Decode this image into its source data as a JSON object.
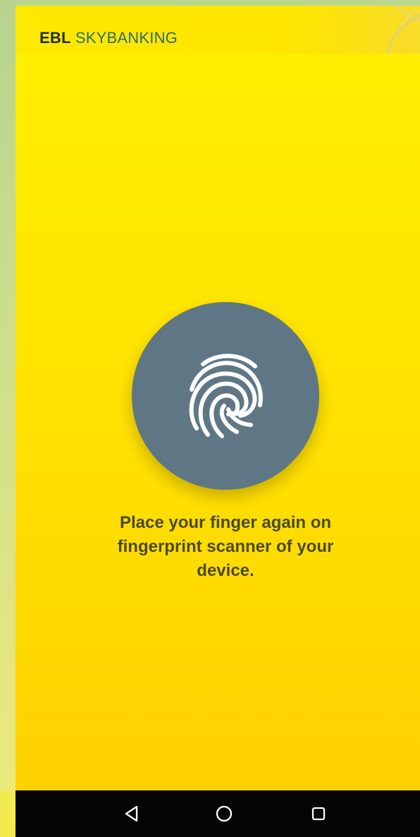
{
  "app": {
    "brand_primary": "EBL",
    "brand_secondary": " SKYBANKING"
  },
  "fingerprint": {
    "icon": "fingerprint-icon",
    "message": "Place your finger again on fingerprint scanner of your device."
  },
  "navigation": {
    "back_icon": "triangle-back-icon",
    "home_icon": "circle-home-icon",
    "recents_icon": "square-recents-icon"
  },
  "colors": {
    "screen_background": "#FFE600",
    "brand_dark": "#1F2D2C",
    "brand_teal": "#2B6D75",
    "fingerprint_circle": "#5F7785",
    "message_text": "#4B4A2C",
    "navigation_bar": "#050505"
  }
}
